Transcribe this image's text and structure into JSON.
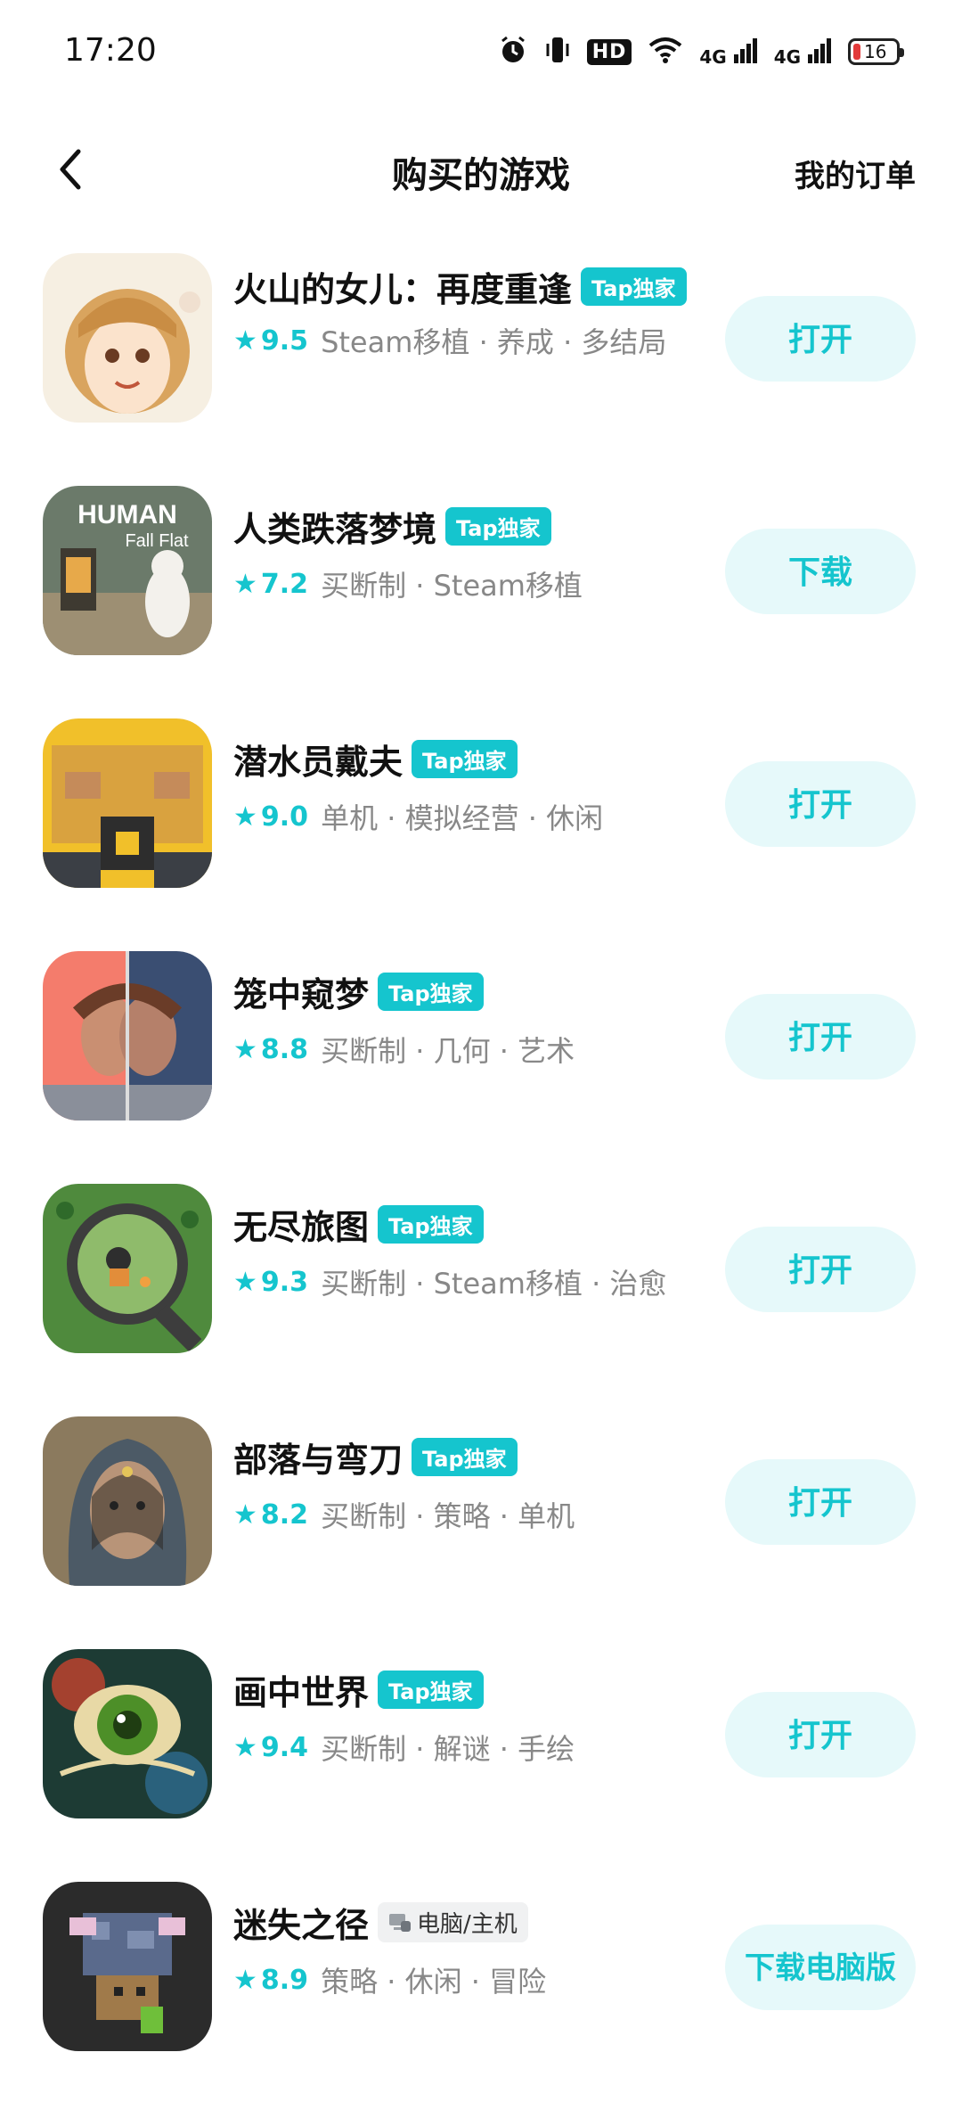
{
  "status": {
    "time": "17:20",
    "icons": [
      "alarm-icon",
      "vibrate-icon",
      "hd-icon",
      "wifi-icon",
      "signal-4g-icon",
      "signal-4g-icon",
      "battery-icon"
    ],
    "hd": "HD",
    "net1": "4G",
    "net2": "4G",
    "battery": "16"
  },
  "header": {
    "back_icon": "back-chevron-icon",
    "title": "购买的游戏",
    "orders": "我的订单"
  },
  "games": [
    {
      "title": "火山的女儿：再度重逢",
      "badge": "Tap独家",
      "score": "9.5",
      "tags": "Steam移植 · 养成 · 多结局",
      "action": "打开"
    },
    {
      "title": "人类跌落梦境",
      "badge": "Tap独家",
      "score": "7.2",
      "tags": "买断制 · Steam移植",
      "action": "下载"
    },
    {
      "title": "潜水员戴夫",
      "badge": "Tap独家",
      "score": "9.0",
      "tags": "单机 · 模拟经营 · 休闲",
      "action": "打开"
    },
    {
      "title": "笼中窥梦",
      "badge": "Tap独家",
      "score": "8.8",
      "tags": "买断制 · 几何 · 艺术",
      "action": "打开"
    },
    {
      "title": "无尽旅图",
      "badge": "Tap独家",
      "score": "9.3",
      "tags": "买断制 · Steam移植 · 治愈",
      "action": "打开"
    },
    {
      "title": "部落与弯刀",
      "badge": "Tap独家",
      "score": "8.2",
      "tags": "买断制 · 策略 · 单机",
      "action": "打开"
    },
    {
      "title": "画中世界",
      "badge": "Tap独家",
      "score": "9.4",
      "tags": "买断制 · 解谜 · 手绘",
      "action": "打开"
    },
    {
      "title": "迷失之径",
      "badge": "电脑/主机",
      "score": "8.9",
      "tags": "策略 · 休闲 · 冒险",
      "action": "下载电脑版"
    }
  ],
  "icon_logo": {
    "line1": "HUMAN",
    "line2": "Fall Flat"
  },
  "colors": {
    "accent": "#15c5ce",
    "button_bg": "#e6f9fa",
    "tag_text": "#888888"
  }
}
